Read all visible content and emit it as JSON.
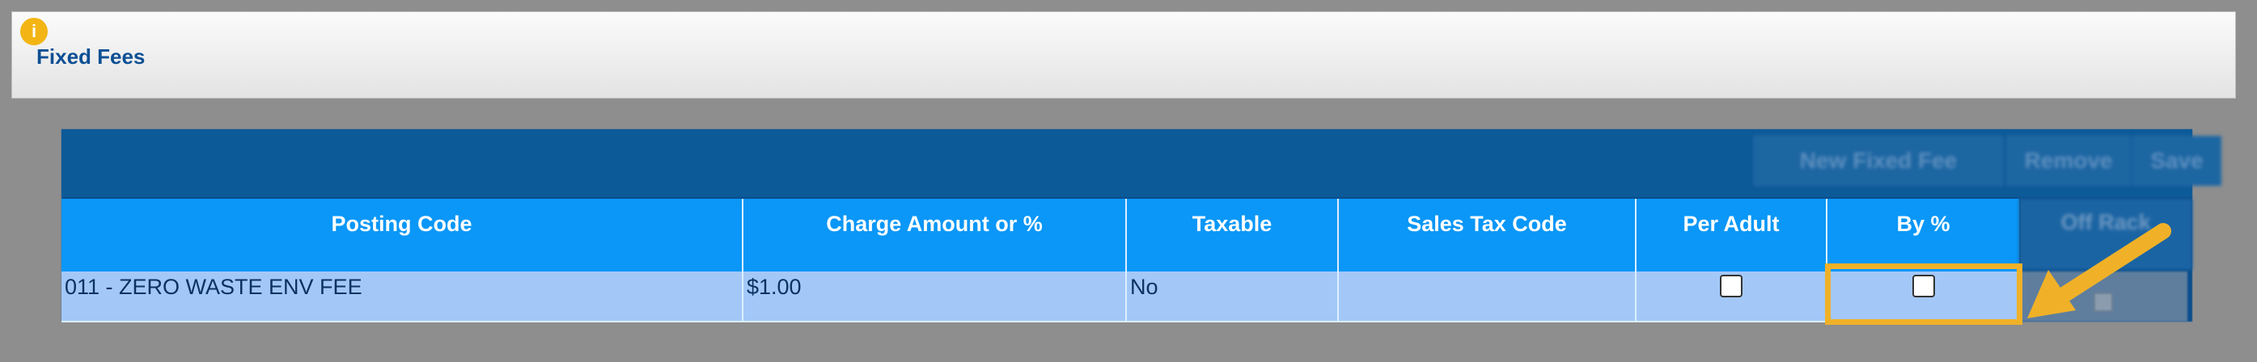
{
  "header": {
    "info_icon_glyph": "i",
    "title": "Fixed Fees"
  },
  "toolbar": {
    "new_label": "New Fixed Fee",
    "remove_label": "Remove",
    "save_label": "Save"
  },
  "grid": {
    "columns": [
      "Posting Code",
      "Charge Amount or %",
      "Taxable",
      "Sales Tax Code",
      "Per Adult",
      "By %",
      "Off Rack"
    ],
    "rows": [
      {
        "posting_code": "011 - ZERO WASTE ENV FEE",
        "charge_amount": "$1.00",
        "taxable": "No",
        "sales_tax_code": "",
        "per_adult": false,
        "by_percent": false,
        "off_rack": false
      }
    ]
  },
  "colors": {
    "header_blue": "#0a97f7",
    "toolbar_blue": "#0d5a98",
    "row_blue": "#a3c8f8",
    "highlight": "#f0b128",
    "title_blue": "#0c4f94"
  }
}
